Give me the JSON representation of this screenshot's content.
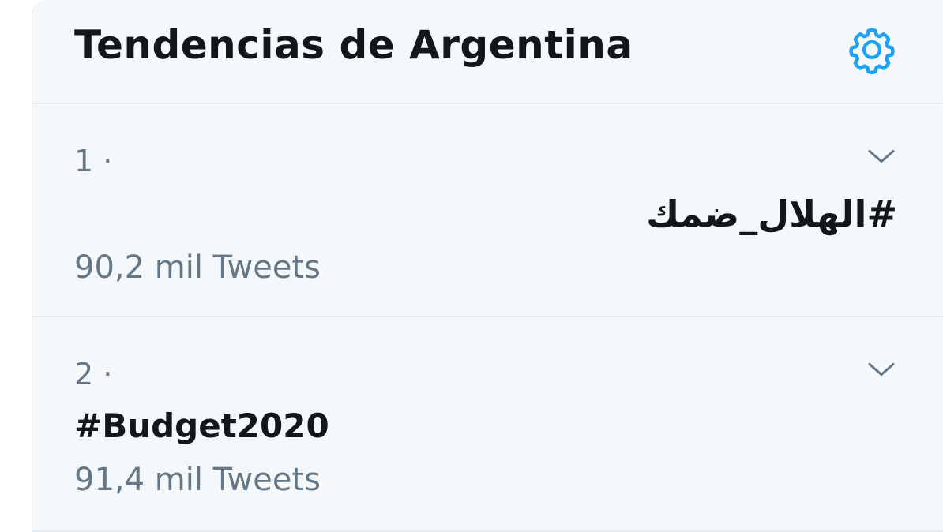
{
  "header": {
    "title": "Tendencias de Argentina",
    "settings_icon": "gear-icon"
  },
  "trends": [
    {
      "rank": "1 ·",
      "name": "#الهلال_ضمك",
      "count": "90,2 mil Tweets",
      "menu_icon": "chevron-down-icon"
    },
    {
      "rank": "2 ·",
      "name": "#Budget2020",
      "count": "91,4 mil Tweets",
      "menu_icon": "chevron-down-icon"
    }
  ],
  "colors": {
    "accent": "#1da1f2",
    "background": "#f5f8fa",
    "divider": "#e6ecf0",
    "primary_text": "#14171a",
    "secondary_text": "#657786"
  }
}
